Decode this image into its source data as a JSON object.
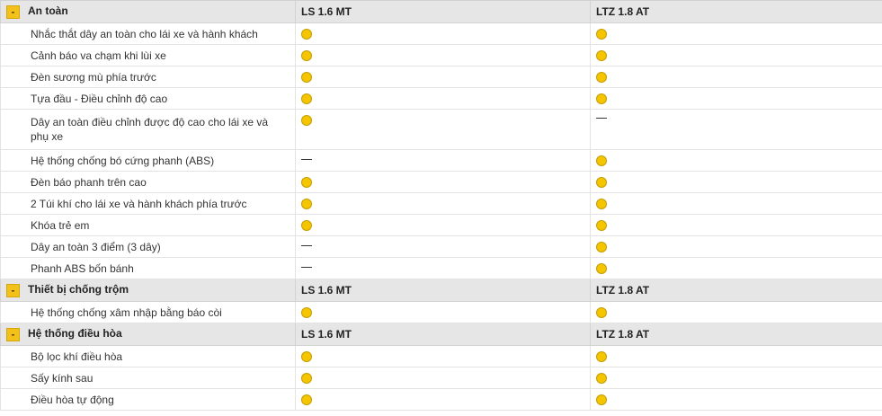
{
  "colors": {
    "accent": "#f2c21a",
    "dot": "#f5c500",
    "header_bg": "#e6e6e6"
  },
  "sections": [
    {
      "title": "An toàn",
      "toggle": "-",
      "col1": "LS 1.6 MT",
      "col2": "LTZ 1.8 AT",
      "rows": [
        {
          "label": "Nhắc thắt dây an toàn cho lái xe và hành khách",
          "ls": "dot",
          "ltz": "dot"
        },
        {
          "label": "Cảnh báo va chạm khi lùi xe",
          "ls": "dot",
          "ltz": "dot"
        },
        {
          "label": "Đèn sương mù phía trước",
          "ls": "dot",
          "ltz": "dot"
        },
        {
          "label": "Tựa đầu - Điều chỉnh độ cao",
          "ls": "dot",
          "ltz": "dot"
        },
        {
          "label": "Dây an toàn điều chỉnh được độ cao cho lái xe và phụ xe",
          "ls": "dot",
          "ltz": "dash"
        },
        {
          "label": "Hệ thống chống bó cứng phanh (ABS)",
          "ls": "dash",
          "ltz": "dot"
        },
        {
          "label": "Đèn báo phanh trên cao",
          "ls": "dot",
          "ltz": "dot"
        },
        {
          "label": "2 Túi khí cho lái xe và hành khách phía trước",
          "ls": "dot",
          "ltz": "dot"
        },
        {
          "label": "Khóa trẻ em",
          "ls": "dot",
          "ltz": "dot"
        },
        {
          "label": "Dây an toàn 3 điểm (3 dây)",
          "ls": "dash",
          "ltz": "dot"
        },
        {
          "label": "Phanh ABS bốn bánh",
          "ls": "dash",
          "ltz": "dot"
        }
      ]
    },
    {
      "title": "Thiết bị chống trộm",
      "toggle": "-",
      "col1": "LS 1.6 MT",
      "col2": "LTZ 1.8 AT",
      "rows": [
        {
          "label": "Hệ thống chống xâm nhập bằng báo còi",
          "ls": "dot",
          "ltz": "dot"
        }
      ]
    },
    {
      "title": "Hệ thống điều hòa",
      "toggle": "-",
      "col1": "LS 1.6 MT",
      "col2": "LTZ 1.8 AT",
      "rows": [
        {
          "label": "Bộ lọc khí điều hòa",
          "ls": "dot",
          "ltz": "dot"
        },
        {
          "label": "Sấy kính sau",
          "ls": "dot",
          "ltz": "dot"
        },
        {
          "label": "Điều hòa tự động",
          "ls": "dot",
          "ltz": "dot"
        }
      ]
    }
  ]
}
